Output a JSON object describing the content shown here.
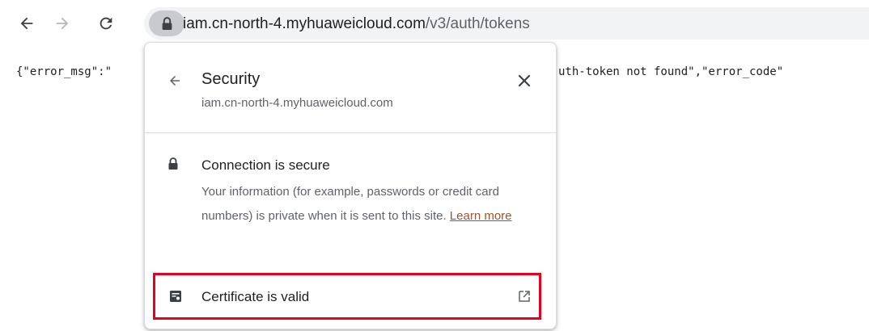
{
  "toolbar": {
    "icons": {
      "back": "arrow-left-icon",
      "forward": "arrow-right-icon",
      "reload": "reload-icon",
      "site_info": "lock-icon"
    },
    "url_host": "iam.cn-north-4.myhuaweicloud.com",
    "url_path": "/v3/auth/tokens"
  },
  "page": {
    "json_prefix": "{\"error_msg\":\"",
    "json_suffix": "uth-token not found\",\"error_code\""
  },
  "popup": {
    "title": "Security",
    "subtitle": "iam.cn-north-4.myhuaweicloud.com",
    "connection": {
      "title": "Connection is secure",
      "description": "Your information (for example, passwords or credit card numbers) is private when it is sent to this site.",
      "learn_more": "Learn more"
    },
    "certificate": {
      "label": "Certificate is valid",
      "highlight_color": "#e8001c"
    },
    "icons": {
      "back": "arrow-left-icon",
      "close": "close-icon",
      "connection": "lock-icon",
      "certificate": "certificate-icon",
      "external": "external-link-icon"
    }
  },
  "colors": {
    "link": "#a0522d",
    "highlight": "#e8001c",
    "omnibox_bg": "#f1f3f4"
  }
}
